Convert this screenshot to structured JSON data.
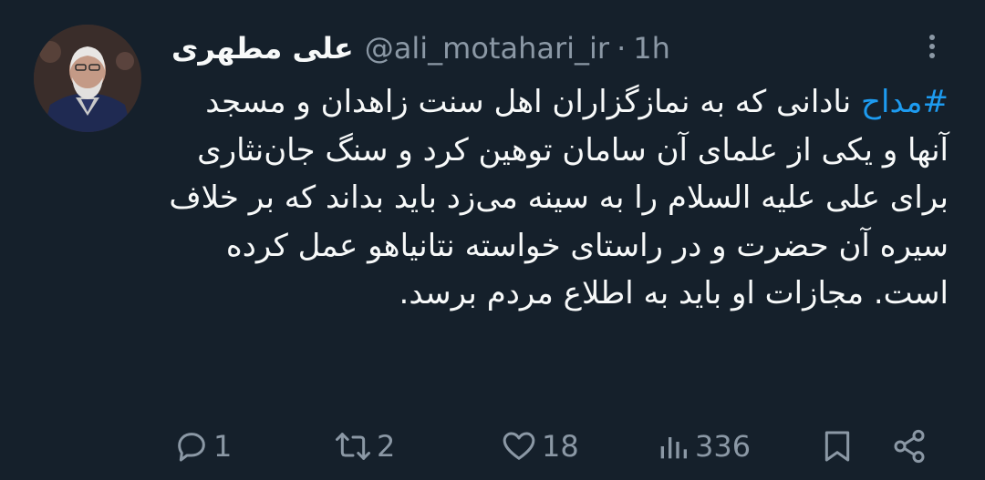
{
  "author": {
    "display_name": "علی مطهری",
    "handle": "@ali_motahari_ir",
    "separator": "·",
    "time": "1h"
  },
  "tweet": {
    "hashtag": "#مداح",
    "text": " نادانی که به نمازگزاران اهل سنت زاهدان و مسجد آنها و یکی از علمای آن سامان توهین کرد و سنگ جان‌نثاری برای علی علیه السلام را به سینه می‌زد باید بداند که بر خلاف سیره آن حضرت و در راستای خواسته نتانیاهو عمل کرده است. مجازات او باید به اطلاع مردم برسد."
  },
  "actions": {
    "replies": "1",
    "retweets": "2",
    "likes": "18",
    "views": "336"
  },
  "colors": {
    "background": "#15202b",
    "text": "#f7f9f9",
    "muted": "#8b98a5",
    "accent": "#1d9bf0"
  },
  "icons": [
    "avatar",
    "more-icon",
    "reply-icon",
    "retweet-icon",
    "like-icon",
    "views-icon",
    "bookmark-icon",
    "share-icon"
  ]
}
